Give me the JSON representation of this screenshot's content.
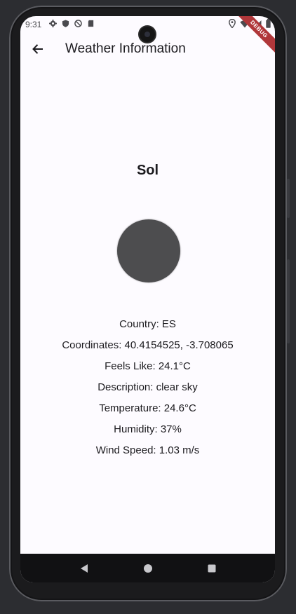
{
  "status_bar": {
    "time": "9:31",
    "left_icons": [
      "settings-icon",
      "shield-icon",
      "do-not-disturb-icon",
      "sd-card-icon"
    ],
    "right_icons": [
      "location-icon",
      "wifi-icon",
      "signal-icon",
      "battery-icon"
    ]
  },
  "debug_banner": "DEBUG",
  "app_bar": {
    "back_icon": "arrow-back-icon",
    "title": "Weather Information"
  },
  "weather": {
    "city": "Sol",
    "icon": "weather-icon",
    "icon_color": "#4d4d4f",
    "details": [
      "Country: ES",
      "Coordinates: 40.4154525, -3.708065",
      "Feels Like: 24.1°C",
      "Description: clear sky",
      "Temperature: 24.6°C",
      "Humidity: 37%",
      "Wind Speed: 1.03 m/s"
    ]
  },
  "nav_bar": {
    "buttons": [
      "back-triangle-icon",
      "home-circle-icon",
      "recents-square-icon"
    ]
  },
  "colors": {
    "background": "#fdfbff",
    "text": "#1c1b1f",
    "banner": "#b0373a",
    "nav": "#111113"
  }
}
